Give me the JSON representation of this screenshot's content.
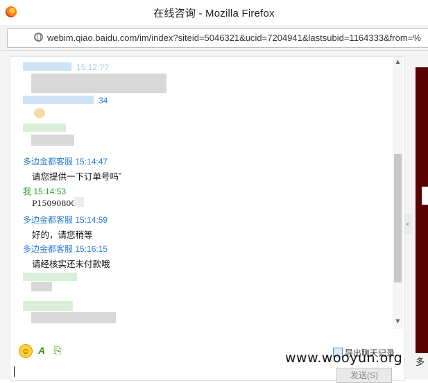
{
  "window": {
    "title": "在线咨询 - Mozilla Firefox",
    "url": "webim.qiao.baidu.com/im/index?siteid=5046321&ucid=7204941&lastsubid=1164333&from=%"
  },
  "messages": [
    {
      "sender": "多边金都客服",
      "time": "15:14:47",
      "text": "请您提供一下订单号吗˘"
    },
    {
      "sender": "我",
      "time": "15:14:53",
      "text": "P150908000"
    },
    {
      "sender": "多边金都客服",
      "time": "15:14:59",
      "text": "好的，请您稍等"
    },
    {
      "sender": "多边金都客服",
      "time": "15:16:15",
      "text": "请经核实还未付款哦"
    }
  ],
  "blurred": {
    "time_fragment_1": "34",
    "time_fragment_2": "15:12:??"
  },
  "toolbar": {
    "export_label": "导出聊天记录",
    "send_label": "发送(S)"
  },
  "right_panel": {
    "text_line1": "多"
  },
  "watermark": "www.wooyun.org",
  "colors": {
    "agent_name": "#2a7bd0",
    "self_name": "#2f9e2f",
    "right_panel_bg": "#5b0000"
  }
}
